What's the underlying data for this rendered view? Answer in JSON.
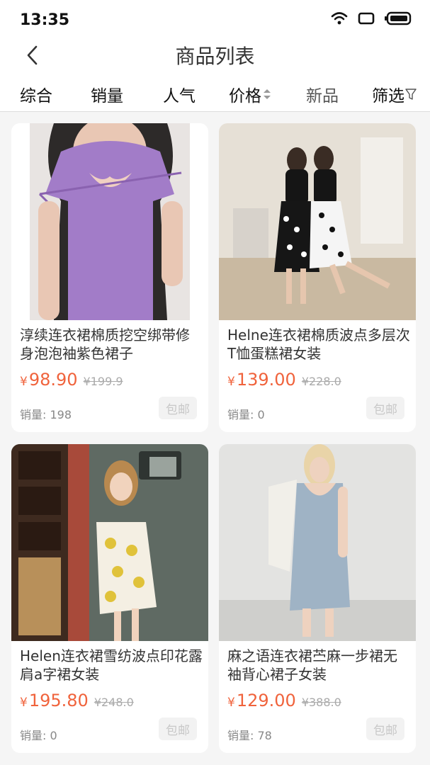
{
  "status_bar": {
    "time": "13:35"
  },
  "header": {
    "title": "商品列表"
  },
  "tabs": [
    {
      "label": "综合"
    },
    {
      "label": "销量"
    },
    {
      "label": "人气"
    },
    {
      "label": "价格"
    },
    {
      "label": "新品"
    },
    {
      "label": "筛选"
    }
  ],
  "products": [
    {
      "name": "淳续连衣裙棉质挖空绑带修身泡泡袖紫色裙子",
      "currency": "¥",
      "price": "98.90",
      "original_price": "¥199.9",
      "sales_label": "销量:",
      "sales": "198",
      "shipping": "包邮"
    },
    {
      "name": "Helne连衣裙棉质波点多层次T恤蛋糕裙女装",
      "currency": "¥",
      "price": "139.00",
      "original_price": "¥228.0",
      "sales_label": "销量:",
      "sales": "0",
      "shipping": "包邮"
    },
    {
      "name": "Helen连衣裙雪纺波点印花露肩a字裙女装",
      "currency": "¥",
      "price": "195.80",
      "original_price": "¥248.0",
      "sales_label": "销量:",
      "sales": "0",
      "shipping": "包邮"
    },
    {
      "name": "麻之语连衣裙苎麻一步裙无袖背心裙子女装",
      "currency": "¥",
      "price": "129.00",
      "original_price": "¥388.0",
      "sales_label": "销量:",
      "sales": "78",
      "shipping": "包邮"
    }
  ],
  "colors": {
    "price": "#f0633c",
    "background": "#f5f5f5"
  }
}
